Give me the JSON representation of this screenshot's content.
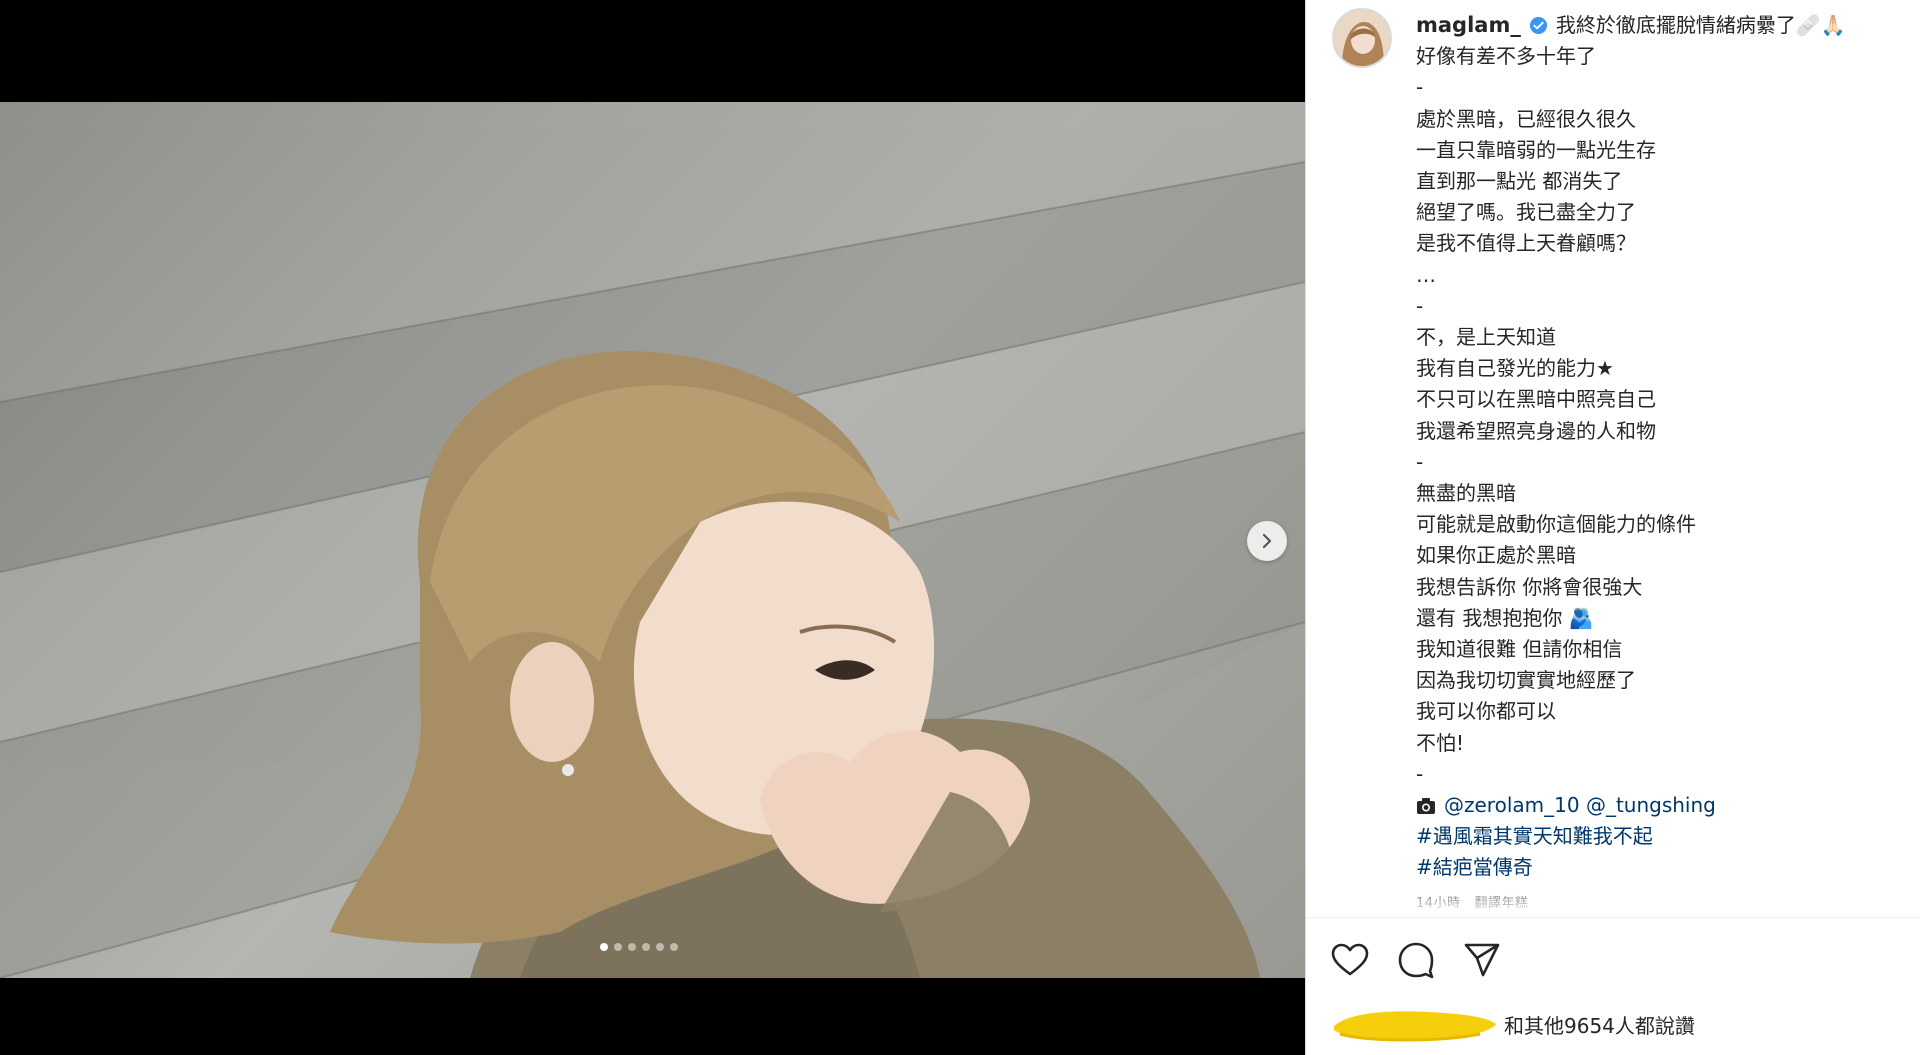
{
  "post": {
    "slide_count": 6,
    "active_slide": 1
  },
  "caption": {
    "username": "maglam_",
    "first_line": "我終於徹底擺脫情緒病纍了🩹🙏🏻",
    "lines": [
      "好像有差不多十年了",
      "-",
      "處於黑暗，已經很久很久",
      "一直只靠暗弱的一點光生存",
      "直到那一點光 都消失了",
      "絕望了嗎。我已盡全力了",
      "是我不值得上天眷顧嗎？",
      "…",
      "-",
      "不，是上天知道",
      "我有自己發光的能力★",
      "不只可以在黑暗中照亮自己",
      "我還希望照亮身邊的人和物",
      "-",
      "無盡的黑暗",
      "可能就是啟動你這個能力的條件",
      "如果你正處於黑暗",
      "我想告訴你 你將會很強大",
      "還有 我想抱抱你 🫂",
      "我知道很難 但請你相信",
      "因為我切切實實地經歷了",
      "我可以你都可以",
      "不怕!",
      "-"
    ],
    "credits": [
      "@zerolam_10",
      "@_tungshing"
    ],
    "hashtags": [
      "#遇風霜其實天知難我不起",
      "#結疤當傳奇"
    ],
    "timestamp": "14小時",
    "translate": "翻譯年糕"
  },
  "likes": {
    "text": "和其他9654人都說讚"
  },
  "icons": {
    "verified": "verified-badge-icon",
    "camera": "camera-icon",
    "like": "heart-icon",
    "comment": "comment-icon",
    "share": "share-icon",
    "next": "chevron-right-icon"
  },
  "colors": {
    "link": "#00376b",
    "verified": "#3897f0",
    "redaction": "#f5cf0b"
  }
}
